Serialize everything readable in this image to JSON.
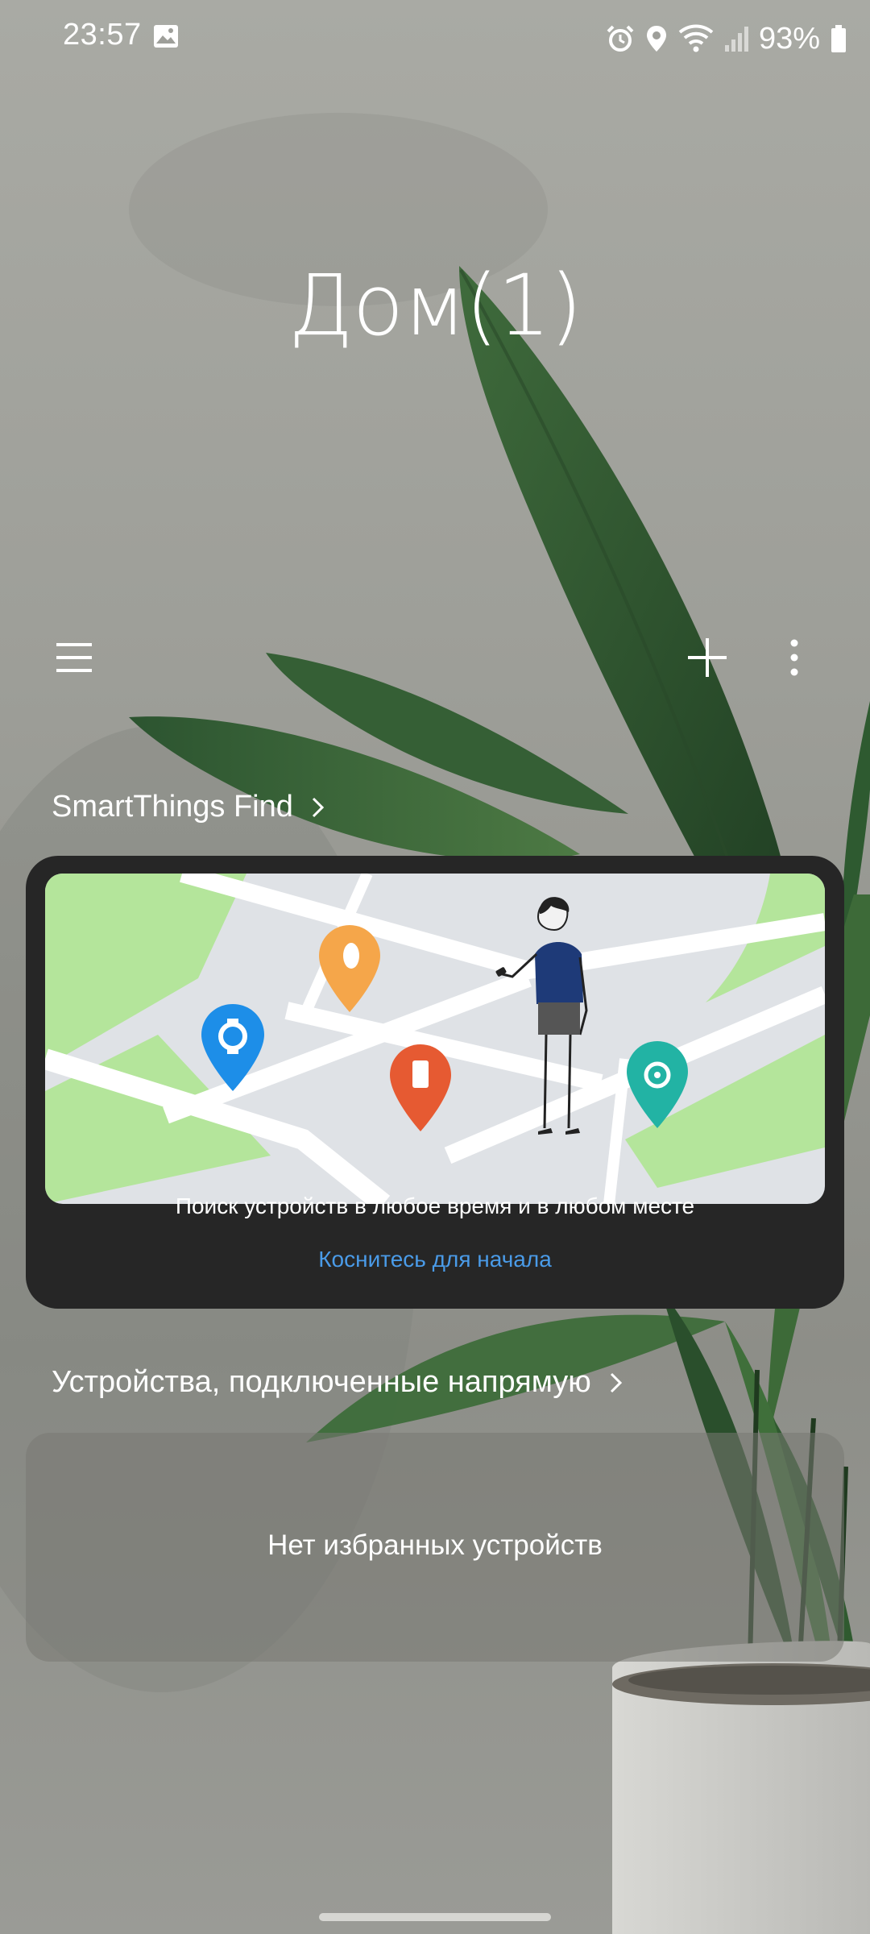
{
  "status_bar": {
    "time": "23:57",
    "battery": "93%",
    "icons": [
      "gallery-icon",
      "alarm-icon",
      "location-icon",
      "wifi-icon",
      "signal-icon",
      "battery-icon"
    ]
  },
  "header": {
    "title": "Дом(1)"
  },
  "toolbar": {
    "menu_icon": "hamburger-icon",
    "add_icon": "plus-icon",
    "more_icon": "more-vertical-icon"
  },
  "find_section": {
    "title": "SmartThings Find",
    "description": "Поиск устройств в любое время и в любом месте",
    "cta": "Коснитесь для начала",
    "colors": {
      "link": "#4a9be8",
      "card": "#262626"
    }
  },
  "devices_section": {
    "title": "Устройства, подключенные напрямую",
    "empty_text": "Нет избранных устройств"
  }
}
